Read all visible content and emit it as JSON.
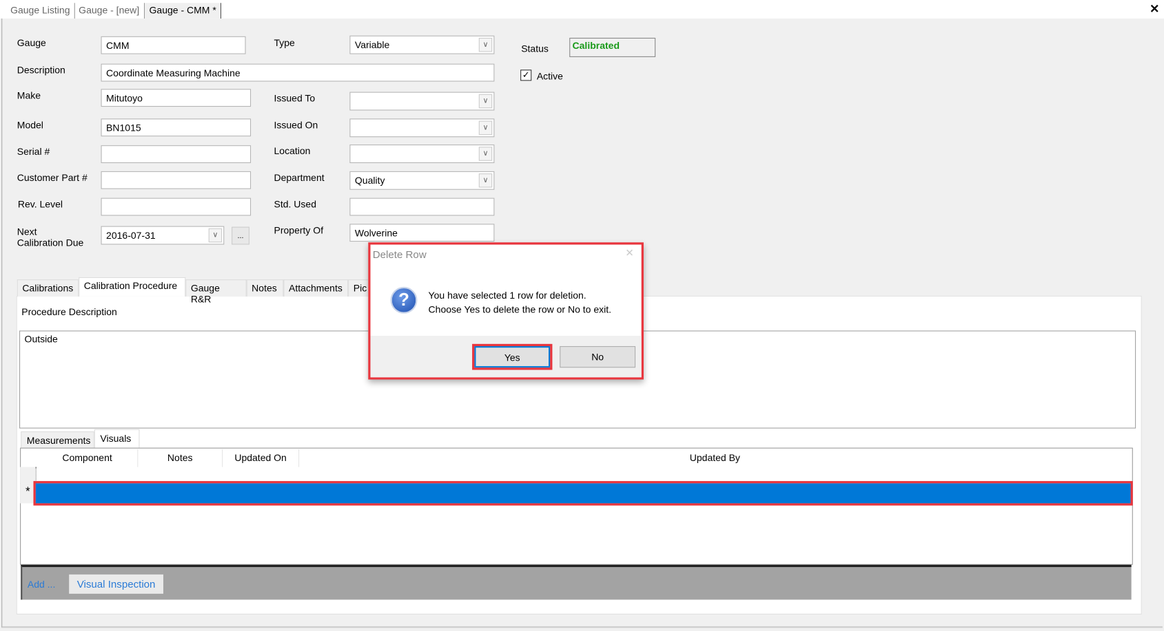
{
  "doc_tabs": [
    "Gauge Listing",
    "Gauge - [new]",
    "Gauge - CMM *"
  ],
  "form": {
    "gauge_label": "Gauge",
    "gauge": "CMM",
    "type_label": "Type",
    "type": "Variable",
    "status_label": "Status",
    "status": "Calibrated",
    "status_color": "#1a9a1a",
    "description_label": "Description",
    "description": "Coordinate Measuring Machine",
    "active_label": "Active",
    "active": true,
    "make_label": "Make",
    "make": "Mitutoyo",
    "issued_to_label": "Issued To",
    "issued_to": "",
    "model_label": "Model",
    "model": "BN1015",
    "issued_on_label": "Issued On",
    "issued_on": "",
    "serial_label": "Serial #",
    "serial": "",
    "location_label": "Location",
    "location": "",
    "customer_part_label": "Customer Part #",
    "customer_part": "",
    "department_label": "Department",
    "department": "Quality",
    "rev_level_label": "Rev. Level",
    "rev_level": "",
    "std_used_label": "Std. Used",
    "std_used": "",
    "next_cal_label_1": "Next",
    "next_cal_label_2": "Calibration Due",
    "next_cal": "2016-07-31",
    "ellipsis": "...",
    "property_of_label": "Property Of",
    "property_of": "Wolverine"
  },
  "tabs": [
    "Calibrations",
    "Calibration Procedure",
    "Gauge R&R",
    "Notes",
    "Attachments",
    "Pic"
  ],
  "procedure": {
    "label": "Procedure Description",
    "text": "Outside"
  },
  "subtabs": [
    "Measurements",
    "Visuals"
  ],
  "grid": {
    "columns": [
      "Component",
      "Notes",
      "Updated On",
      "Updated By"
    ],
    "new_row_marker": "*",
    "selection_color": "#0078d7"
  },
  "bottom": {
    "add": "Add ...",
    "visual_inspection": "Visual Inspection"
  },
  "dialog": {
    "title": "Delete Row",
    "line1": "You have selected 1 row for deletion.",
    "line2": "Choose Yes to delete the row or No to exit.",
    "yes": "Yes",
    "no": "No",
    "icon": "question-icon",
    "highlight_color": "#e8353d"
  }
}
